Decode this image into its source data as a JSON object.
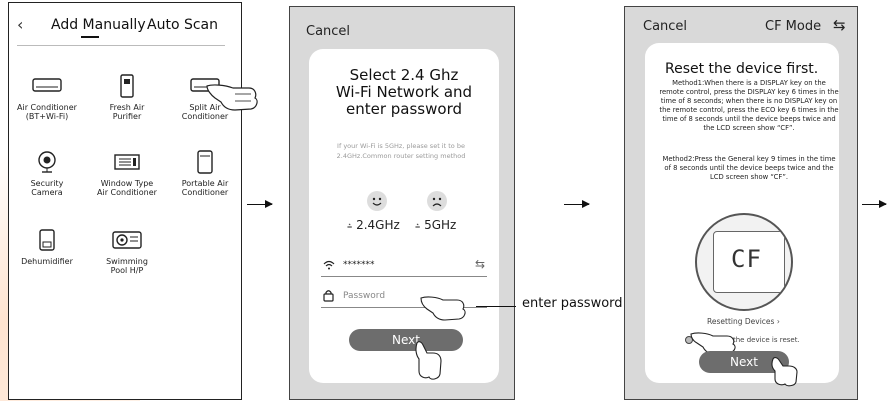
{
  "panel1": {
    "back_icon": "chevron-left-icon",
    "tabs": [
      {
        "label": "Add Manually",
        "active": true
      },
      {
        "label": "Auto Scan",
        "active": false
      }
    ],
    "devices": [
      {
        "label": "Air Conditioner\n(BT+Wi-Fi)",
        "icon": "air-conditioner-icon"
      },
      {
        "label": "Fresh Air\nPurifier",
        "icon": "fresh-air-purifier-icon"
      },
      {
        "label": "Split Air\nConditioner",
        "icon": "split-air-conditioner-icon"
      },
      {
        "label": "Security\nCamera",
        "icon": "security-camera-icon"
      },
      {
        "label": "Window Type\nAir Conditioner",
        "icon": "window-ac-icon"
      },
      {
        "label": "Portable Air\nConditioner",
        "icon": "portable-ac-icon"
      },
      {
        "label": "Dehumidifier",
        "icon": "dehumidifier-icon"
      },
      {
        "label": "Swimming\nPool H/P",
        "icon": "pool-heatpump-icon"
      }
    ]
  },
  "panel2": {
    "cancel": "Cancel",
    "title_line1": "Select 2.4 Ghz",
    "title_line2": "Wi-Fi Network and",
    "title_line3": "enter password",
    "note": "If your Wi-Fi is 5GHz, please set it to be 2.4GHz.Common router setting method",
    "band_good": "2.4GHz",
    "band_bad": "5GHz",
    "wifi_value": "*******",
    "password_placeholder": "Password",
    "next": "Next"
  },
  "callout_enter_password": "enter password",
  "panel3": {
    "cancel": "Cancel",
    "mode": "CF Mode",
    "title": "Reset the device first.",
    "method1": "Method1:When there is a DISPLAY key on the remote control, press the DISPLAY key 6 times in the time of 8 seconds; when there is no DISPLAY key on the remote control, press the ECO key 6 times in the time of 8 seconds until the device beeps twice and the LCD screen show “CF”.",
    "method2": "Method2:Press the General key 9 times in the time of 8 seconds until the device beeps twice and the LCD screen show “CF”.",
    "display_text": "CF",
    "resetting": "Resetting Devices ›",
    "reset_note": "the device is reset.",
    "next": "Next"
  }
}
